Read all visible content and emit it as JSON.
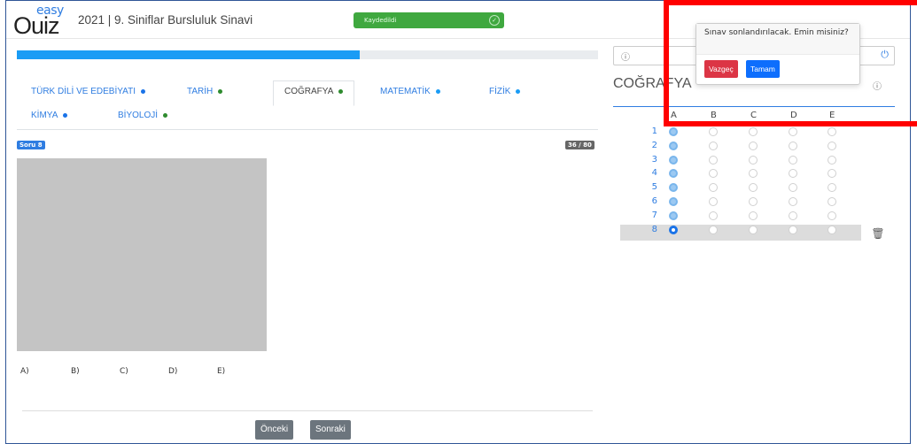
{
  "header": {
    "logo_small": "easy",
    "logo_large": "Ouiz",
    "title": "2021 | 9. Siniflar Bursluluk Sinavi",
    "saved_label": "Kaydedildi",
    "saved_icon": "check-circle-icon"
  },
  "progress": {
    "fraction": 0.59,
    "color": "#1a9cf5"
  },
  "tabs": [
    {
      "label": "TÜRK DİLİ VE EDEBİYATI",
      "dot": "#1a73e8",
      "active": false
    },
    {
      "label": "TARİH",
      "dot": "#2e8b2e",
      "active": false
    },
    {
      "label": "COĞRAFYA",
      "dot": "#2e8b2e",
      "active": true
    },
    {
      "label": "MATEMATİK",
      "dot": "#1a9cf5",
      "active": false
    },
    {
      "label": "FİZİK",
      "dot": "#1a9cf5",
      "active": false
    },
    {
      "label": "KİMYA",
      "dot": "#1a73e8",
      "active": false
    },
    {
      "label": "BİYOLOJİ",
      "dot": "#2e8b2e",
      "active": false
    }
  ],
  "question": {
    "badge": "Soru 8",
    "count": "36 / 80",
    "options": [
      "A)",
      "B)",
      "C)",
      "D)",
      "E)"
    ]
  },
  "nav": {
    "prev": "Önceki",
    "next": "Sonraki"
  },
  "panel": {
    "info_icon": "info-icon",
    "power_icon": "power-icon",
    "subject": "COĞRAFYA",
    "columns": [
      "A",
      "B",
      "C",
      "D",
      "E"
    ],
    "rows": [
      {
        "num": "1",
        "selected": 0
      },
      {
        "num": "2",
        "selected": 0
      },
      {
        "num": "3",
        "selected": 0
      },
      {
        "num": "4",
        "selected": 0
      },
      {
        "num": "5",
        "selected": 0
      },
      {
        "num": "6",
        "selected": 0
      },
      {
        "num": "7",
        "selected": 0
      },
      {
        "num": "8",
        "selected": 0,
        "current": true
      }
    ]
  },
  "popover": {
    "message": "Sınav sonlandırılacak. Emin misiniz?",
    "cancel": "Vazgeç",
    "confirm": "Tamam",
    "cancel_color": "#dc3545",
    "confirm_color": "#0d6efd"
  },
  "highlight_color": "#ff0000"
}
